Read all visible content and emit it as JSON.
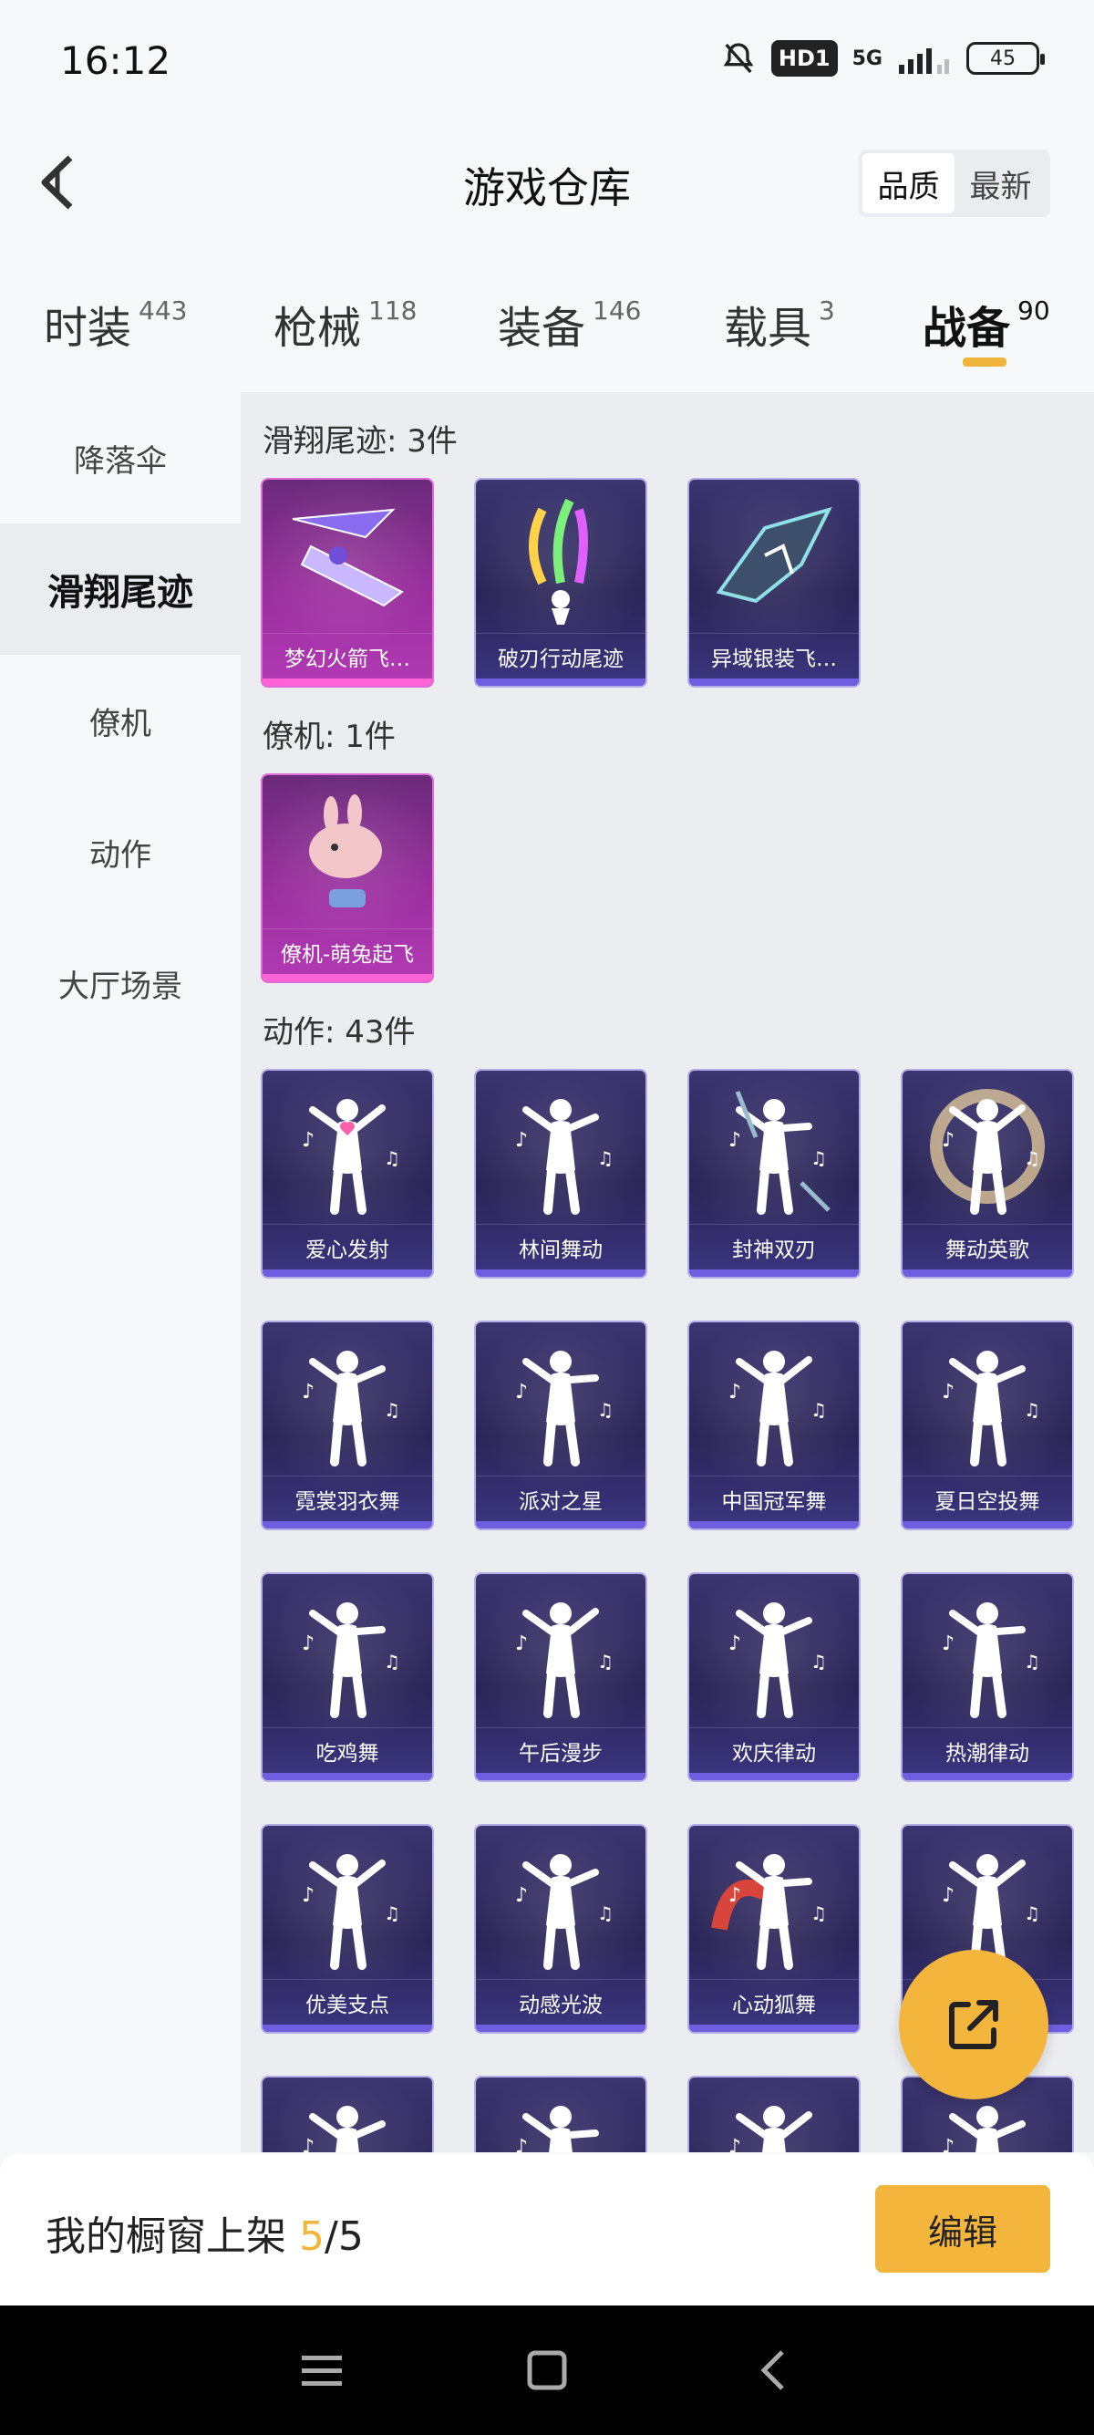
{
  "status_bar": {
    "time": "16:12",
    "hd_label": "HD1",
    "network_label": "5G",
    "battery": "45"
  },
  "header": {
    "title": "游戏仓库",
    "sort_options": [
      "品质",
      "最新"
    ],
    "active_sort": "品质"
  },
  "tabs": [
    {
      "label": "时装",
      "count": "443"
    },
    {
      "label": "枪械",
      "count": "118"
    },
    {
      "label": "装备",
      "count": "146"
    },
    {
      "label": "载具",
      "count": "3"
    },
    {
      "label": "战备",
      "count": "90"
    }
  ],
  "active_tab": "战备",
  "sidebar": {
    "items": [
      "降落伞",
      "滑翔尾迹",
      "僚机",
      "动作",
      "大厅场景"
    ],
    "active": "滑翔尾迹"
  },
  "sections": [
    {
      "title": "滑翔尾迹: 3件",
      "items": [
        {
          "label": "梦幻火箭飞…",
          "icon": "rocket-glider-icon",
          "rarity": "legendary"
        },
        {
          "label": "破刃行动尾迹",
          "icon": "smoke-trail-icon",
          "rarity": "epic"
        },
        {
          "label": "异域银装飞…",
          "icon": "silver-wing-icon",
          "rarity": "epic"
        }
      ]
    },
    {
      "title": "僚机: 1件",
      "items": [
        {
          "label": "僚机-萌兔起飞",
          "icon": "bunny-drone-icon",
          "rarity": "legendary"
        }
      ]
    },
    {
      "title": "动作: 43件",
      "items": [
        {
          "label": "爱心发射",
          "icon": "heart-dance-icon"
        },
        {
          "label": "林间舞动",
          "icon": "dance-pose-icon"
        },
        {
          "label": "封神双刃",
          "icon": "twin-blade-icon"
        },
        {
          "label": "舞动英歌",
          "icon": "swirl-dance-icon"
        },
        {
          "label": "霓裳羽衣舞",
          "icon": "dance-pose-icon"
        },
        {
          "label": "派对之星",
          "icon": "dance-pose-icon"
        },
        {
          "label": "中国冠军舞",
          "icon": "dance-pose-icon"
        },
        {
          "label": "夏日空投舞",
          "icon": "dance-pose-icon"
        },
        {
          "label": "吃鸡舞",
          "icon": "dance-pose-icon"
        },
        {
          "label": "午后漫步",
          "icon": "dance-pose-icon"
        },
        {
          "label": "欢庆律动",
          "icon": "dance-pose-icon"
        },
        {
          "label": "热潮律动",
          "icon": "dance-pose-icon"
        },
        {
          "label": "优美支点",
          "icon": "dance-pose-icon"
        },
        {
          "label": "动感光波",
          "icon": "dance-pose-icon"
        },
        {
          "label": "心动狐舞",
          "icon": "fox-dance-icon"
        },
        {
          "label": "",
          "icon": "dance-pose-icon"
        },
        {
          "label": "",
          "icon": "dance-pose-icon"
        },
        {
          "label": "",
          "icon": "dance-pose-icon"
        },
        {
          "label": "",
          "icon": "dance-pose-icon"
        },
        {
          "label": "",
          "icon": "dance-pose-icon"
        }
      ]
    }
  ],
  "showcase": {
    "label": "我的橱窗上架",
    "current": "5",
    "total": "/5",
    "edit_label": "编辑"
  },
  "colors": {
    "accent": "#f3b53b",
    "card_purple": "#2a2556",
    "card_pink": "#b23ab4"
  }
}
